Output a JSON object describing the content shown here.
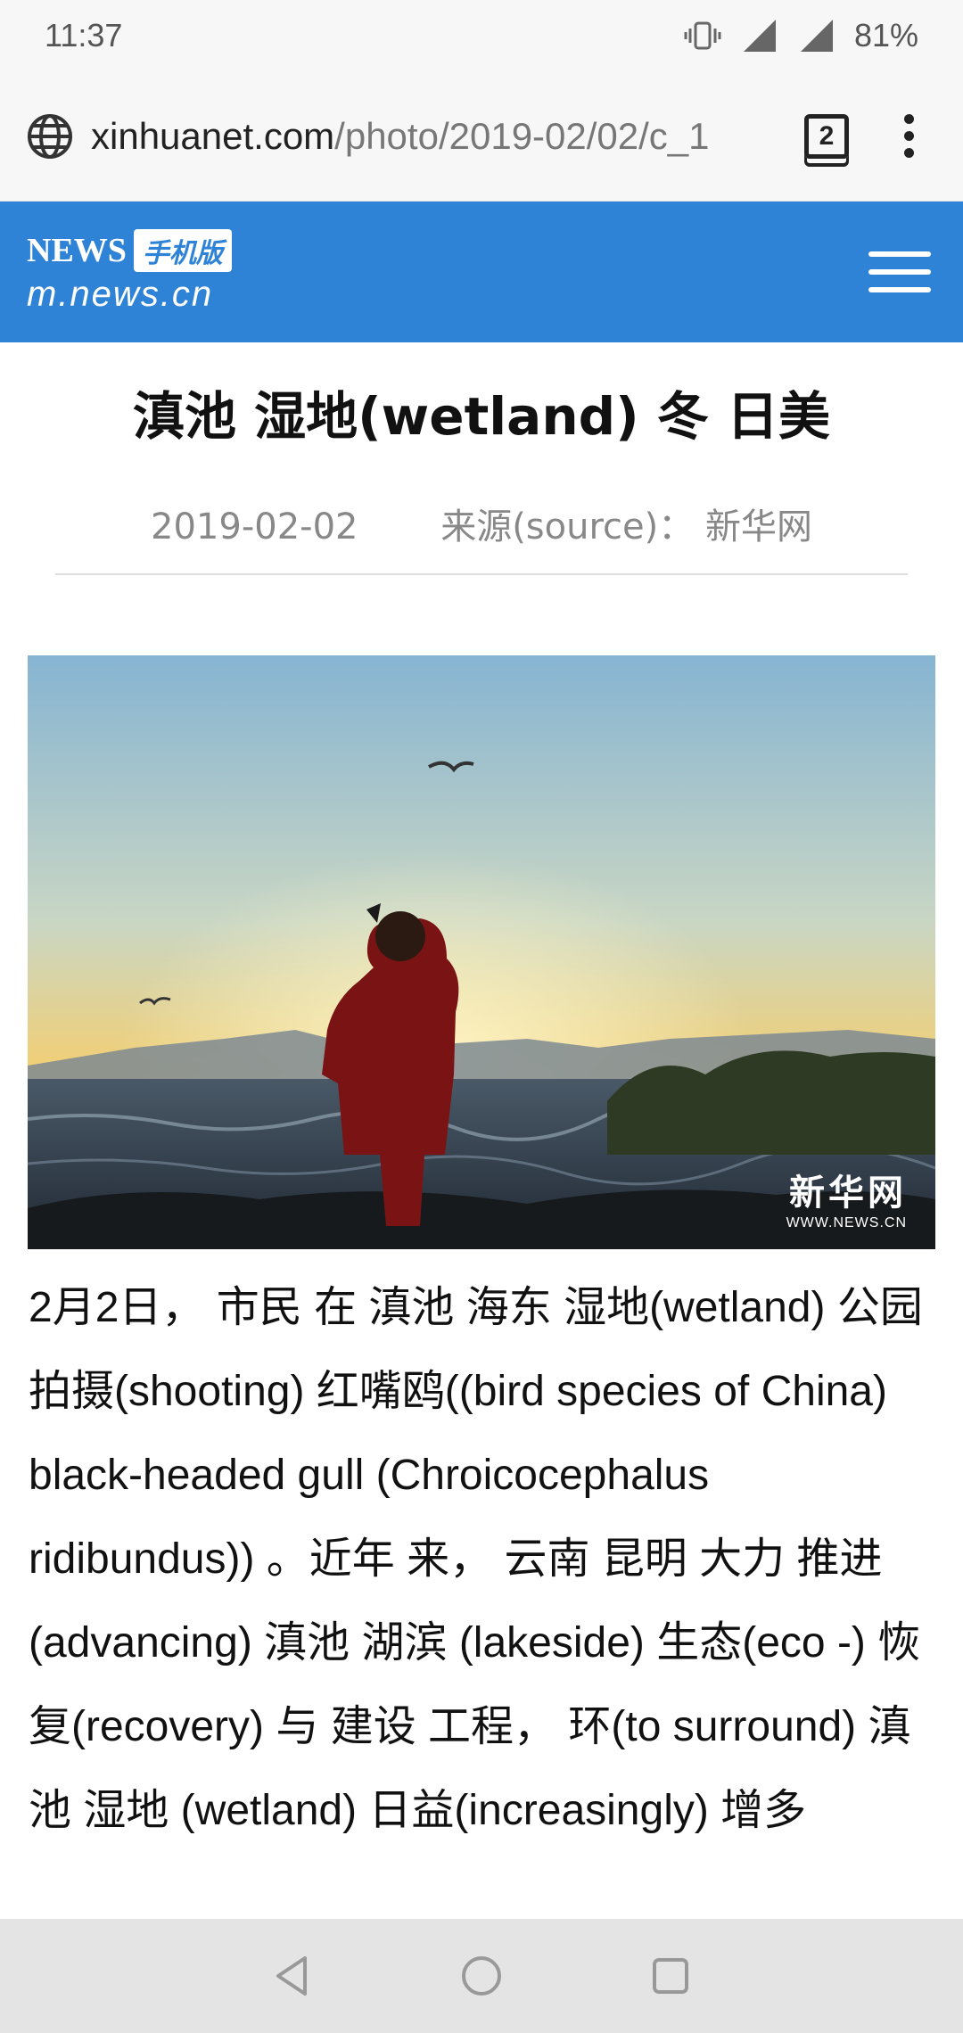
{
  "status_bar": {
    "time": "11:37",
    "battery": "81%",
    "network": "4G"
  },
  "browser": {
    "url_domain": "xinhuanet.com",
    "url_path": "/photo/2019-02/02/c_1",
    "tab_count": "2"
  },
  "site": {
    "logo_badge": "手机版",
    "logo_domain": "m.news.cn",
    "logo_news": "NEWS"
  },
  "article": {
    "title": "滇池 湿地(wetland) 冬 日美",
    "date": "2019-02-02",
    "source": "来源(source)： 新华网",
    "body": "2月2日， 市民 在 滇池 海东 湿地(wetland)  公园 拍摄(shooting) 红嘴鸥((bird species of China) black-headed gull (Chroicocephalus ridibundus)) 。近年 来，  云南 昆明 大力 推进(advancing) 滇池 湖滨 (lakeside) 生态(eco -) 恢复(recovery) 与 建设 工程， 环(to surround) 滇池 湿地 (wetland) 日益(increasingly) 增多"
  },
  "photo": {
    "watermark_cn": "新华网",
    "watermark_url": "WWW.NEWS.CN"
  }
}
